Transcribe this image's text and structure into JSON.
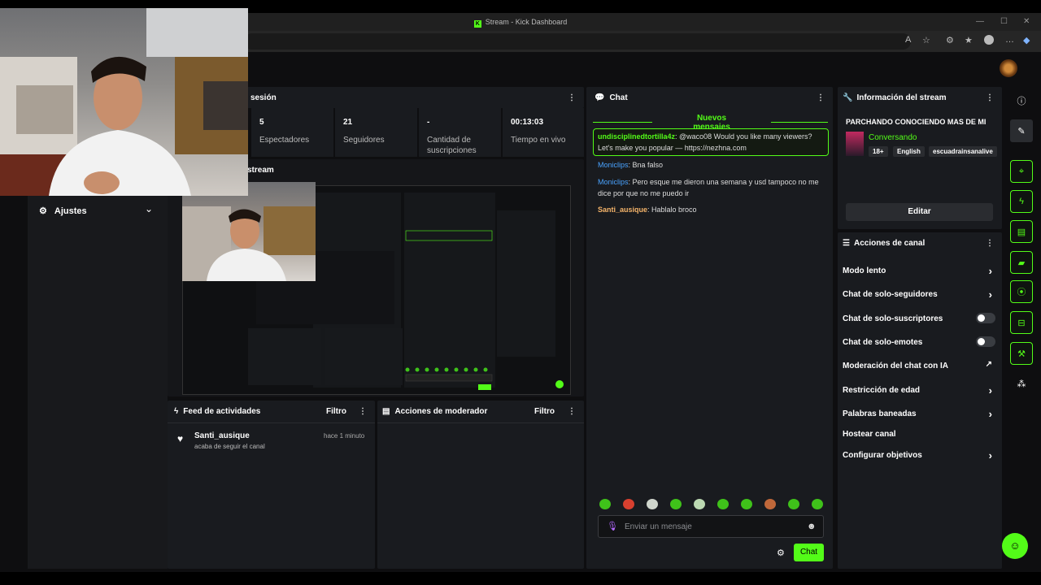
{
  "window": {
    "title": "Stream - Kick Dashboard"
  },
  "session": {
    "title_fragment": "sesión"
  },
  "stats": [
    {
      "value": "5",
      "label": "Espectadores"
    },
    {
      "value": "21",
      "label": "Seguidores"
    },
    {
      "value": "-",
      "label": "Cantidad de suscripciones"
    },
    {
      "value": "00:13:03",
      "label": "Tiempo en vivo"
    }
  ],
  "stream_preview": {
    "title_fragment": "stream"
  },
  "sidebar": {
    "settings_label": "Ajustes"
  },
  "chat": {
    "title": "Chat",
    "new_messages": "Nuevos mensajes",
    "messages": [
      {
        "user": "undisciplinedtortilla4z",
        "text": ": @waco08 Would you like many viewers? Let's make you popular — https://nezhna.com"
      },
      {
        "user": "Moniclips",
        "text": ": Bna falso"
      },
      {
        "user": "Moniclips",
        "text": ": Pero esque me dieron una semana y usd tampoco no me dice por que no me puedo ir"
      },
      {
        "user": "Santi_ausique",
        "text": ": Hablalo broco"
      }
    ],
    "input_placeholder": "Enviar un mensaje",
    "send_label": "Chat"
  },
  "stream_info": {
    "header": "Información del stream",
    "title": "PARCHANDO CONOCIENDO MAS DE MI",
    "category": "Conversando",
    "tags": [
      "18+",
      "English",
      "escuadrainsanalive"
    ],
    "edit_label": "Editar"
  },
  "channel_actions": {
    "header": "Acciones de canal",
    "items": [
      {
        "label": "Modo lento",
        "control": "chevron"
      },
      {
        "label": "Chat de solo-seguidores",
        "control": "chevron"
      },
      {
        "label": "Chat de solo-suscriptores",
        "control": "toggle"
      },
      {
        "label": "Chat de solo-emotes",
        "control": "toggle"
      },
      {
        "label": "Moderación del chat con IA",
        "control": "external"
      },
      {
        "label": "Restricción de edad",
        "control": "chevron"
      },
      {
        "label": "Palabras baneadas",
        "control": "chevron"
      },
      {
        "label": "Hostear canal",
        "control": "none"
      },
      {
        "label": "Configurar objetivos",
        "control": "chevron"
      }
    ]
  },
  "activity_feed": {
    "title": "Feed de actividades",
    "filter_label": "Filtro",
    "items": [
      {
        "user": "Santi_ausique",
        "time": "hace 1 minuto",
        "action": "acaba de seguir el canal"
      }
    ]
  },
  "mod_actions": {
    "title": "Acciones de moderador",
    "filter_label": "Filtro"
  },
  "colors": {
    "accent": "#53fc18",
    "panel": "#191b1f",
    "background": "#0e0e10"
  }
}
